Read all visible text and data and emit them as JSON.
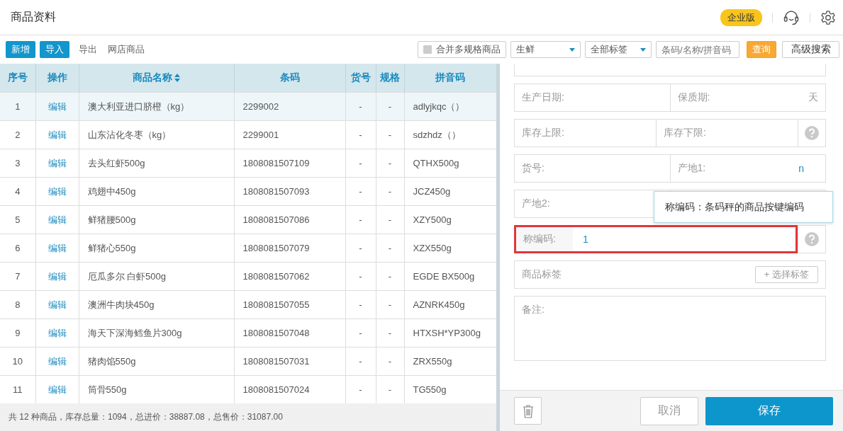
{
  "header": {
    "title": "商品资料",
    "badge": "企业版"
  },
  "toolbar": {
    "buttons": [
      {
        "label": "新增",
        "kind": "primary"
      },
      {
        "label": "导入",
        "kind": "primary"
      },
      {
        "label": "导出",
        "kind": "link"
      },
      {
        "label": "网店商品",
        "kind": "link"
      }
    ],
    "merge_checkbox": {
      "label": "合并多规格商品",
      "checked": false
    },
    "dropdowns": [
      {
        "value": "生鲜"
      },
      {
        "value": "全部标签"
      }
    ],
    "search": {
      "placeholder": "条码/名称/拼音码"
    },
    "query_button": "查询",
    "advanced_button": "高级搜索"
  },
  "table": {
    "columns": [
      {
        "label": "序号",
        "sortable": false
      },
      {
        "label": "操作",
        "sortable": false
      },
      {
        "label": "商品名称",
        "sortable": true
      },
      {
        "label": "条码",
        "sortable": false
      },
      {
        "label": "货号",
        "sortable": false
      },
      {
        "label": "规格",
        "sortable": false
      },
      {
        "label": "拼音码",
        "sortable": false
      }
    ],
    "rows": [
      {
        "no": "1",
        "action": "编辑",
        "name": "澳大利亚进口脐橙（kg）",
        "barcode": "2299002",
        "item_no": "-",
        "spec": "-",
        "pinyin": "adlyjkqc（）",
        "selected": true
      },
      {
        "no": "2",
        "action": "编辑",
        "name": "山东沾化冬枣（kg）",
        "barcode": "2299001",
        "item_no": "-",
        "spec": "-",
        "pinyin": "sdzhdz（）",
        "selected": false
      },
      {
        "no": "3",
        "action": "编辑",
        "name": "去头红虾500g",
        "barcode": "1808081507109",
        "item_no": "-",
        "spec": "-",
        "pinyin": "QTHX500g",
        "selected": false
      },
      {
        "no": "4",
        "action": "编辑",
        "name": "鸡翅中450g",
        "barcode": "1808081507093",
        "item_no": "-",
        "spec": "-",
        "pinyin": "JCZ450g",
        "selected": false
      },
      {
        "no": "5",
        "action": "编辑",
        "name": "鲜猪腰500g",
        "barcode": "1808081507086",
        "item_no": "-",
        "spec": "-",
        "pinyin": "XZY500g",
        "selected": false
      },
      {
        "no": "6",
        "action": "编辑",
        "name": "鲜猪心550g",
        "barcode": "1808081507079",
        "item_no": "-",
        "spec": "-",
        "pinyin": "XZX550g",
        "selected": false
      },
      {
        "no": "7",
        "action": "编辑",
        "name": "厄瓜多尔 白虾500g",
        "barcode": "1808081507062",
        "item_no": "-",
        "spec": "-",
        "pinyin": "EGDE BX500g",
        "selected": false
      },
      {
        "no": "8",
        "action": "编辑",
        "name": "澳洲牛肉块450g",
        "barcode": "1808081507055",
        "item_no": "-",
        "spec": "-",
        "pinyin": "AZNRK450g",
        "selected": false
      },
      {
        "no": "9",
        "action": "编辑",
        "name": "海天下深海鳕鱼片300g",
        "barcode": "1808081507048",
        "item_no": "-",
        "spec": "-",
        "pinyin": "HTXSH*YP300g",
        "selected": false
      },
      {
        "no": "10",
        "action": "编辑",
        "name": "猪肉馅550g",
        "barcode": "1808081507031",
        "item_no": "-",
        "spec": "-",
        "pinyin": "ZRX550g",
        "selected": false
      },
      {
        "no": "11",
        "action": "编辑",
        "name": "筒骨550g",
        "barcode": "1808081507024",
        "item_no": "-",
        "spec": "-",
        "pinyin": "TG550g",
        "selected": false
      }
    ]
  },
  "summary": "共 12 种商品，库存总量：1094，总进价：38887.08，总售价：31087.00",
  "form": {
    "rows": [
      {
        "kind": "pair",
        "fields": [
          {
            "label": "生产日期:"
          },
          {
            "label": "保质期:",
            "suffix": "天"
          }
        ]
      },
      {
        "kind": "pair",
        "fields": [
          {
            "label": "库存上限:"
          },
          {
            "label": "库存下限:",
            "help": true
          }
        ]
      },
      {
        "kind": "pair",
        "fields": [
          {
            "label": "货号:"
          },
          {
            "label": "产地1:",
            "value": "n"
          }
        ]
      },
      {
        "kind": "pair",
        "fields": [
          {
            "label": "产地2:"
          }
        ]
      },
      {
        "kind": "single",
        "label": "称编码:",
        "value": "1",
        "help": true,
        "highlighted": true
      },
      {
        "kind": "tags",
        "label": "商品标签",
        "button": "+ 选择标签"
      },
      {
        "kind": "textarea",
        "label": "备注:"
      }
    ],
    "tooltip": "称编码：条码秤的商品按键编码",
    "cancel_button": "取消",
    "save_button": "保存"
  }
}
